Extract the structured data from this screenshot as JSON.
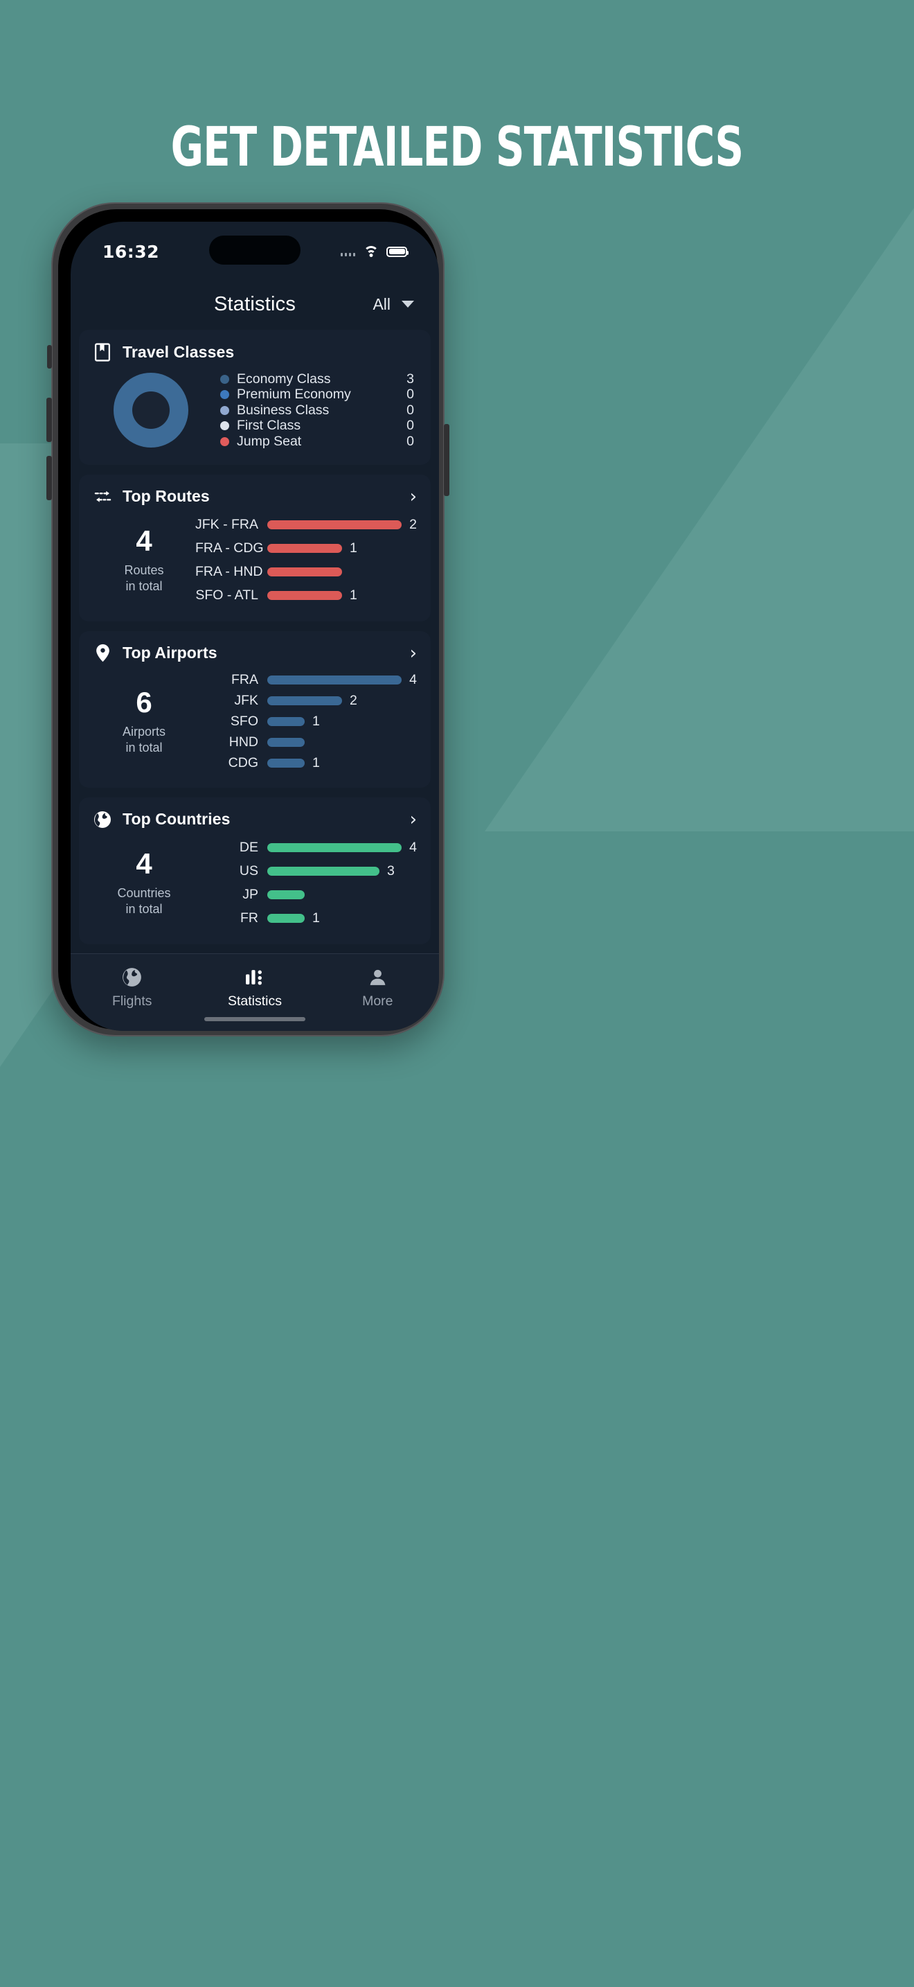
{
  "promo": {
    "headline": "GET DETAILED STATISTICS"
  },
  "theme": {
    "background": "#54918A",
    "screen_bg": "#141E2B",
    "card_bg": "#172130",
    "accent_blue": "#3D6B97",
    "accent_red": "#DC5A57",
    "accent_green": "#43C08A"
  },
  "status_bar": {
    "time": "16:32",
    "wifi": "wifi-icon",
    "battery": "battery-icon",
    "signal": "signal-dots-icon"
  },
  "nav": {
    "title": "Statistics",
    "filter_label": "All",
    "filter_caret": "chevron-down-icon"
  },
  "travel_classes": {
    "icon": "book-bookmark-icon",
    "title": "Travel Classes",
    "legend": [
      {
        "label": "Economy Class",
        "value": "3",
        "color": "#3A6389"
      },
      {
        "label": "Premium Economy",
        "value": "0",
        "color": "#3D79BE"
      },
      {
        "label": "Business Class",
        "value": "0",
        "color": "#90A8D0"
      },
      {
        "label": "First Class",
        "value": "0",
        "color": "#DDE3EC"
      },
      {
        "label": "Jump Seat",
        "value": "0",
        "color": "#E05C5C"
      }
    ]
  },
  "top_routes": {
    "icon": "route-arrows-icon",
    "title": "Top Routes",
    "chevron": "chevron-right-icon",
    "total_number": "4",
    "total_caption_line1": "Routes",
    "total_caption_line2": "in total",
    "rows": [
      {
        "label": "JFK - FRA",
        "value": "2",
        "pct": 100
      },
      {
        "label": "FRA - CDG",
        "value": "1",
        "pct": 50
      },
      {
        "label": "FRA - HND",
        "value": "",
        "pct": 50
      },
      {
        "label": "SFO - ATL",
        "value": "1",
        "pct": 50
      }
    ]
  },
  "top_airports": {
    "icon": "location-pin-icon",
    "title": "Top Airports",
    "chevron": "chevron-right-icon",
    "total_number": "6",
    "total_caption_line1": "Airports",
    "total_caption_line2": "in total",
    "rows": [
      {
        "label": "FRA",
        "value": "4",
        "pct": 100
      },
      {
        "label": "JFK",
        "value": "2",
        "pct": 50
      },
      {
        "label": "SFO",
        "value": "1",
        "pct": 25
      },
      {
        "label": "HND",
        "value": "",
        "pct": 25
      },
      {
        "label": "CDG",
        "value": "1",
        "pct": 25
      }
    ]
  },
  "top_countries": {
    "icon": "globe-icon",
    "title": "Top Countries",
    "chevron": "chevron-right-icon",
    "total_number": "4",
    "total_caption_line1": "Countries",
    "total_caption_line2": "in total",
    "rows": [
      {
        "label": "DE",
        "value": "4",
        "pct": 100
      },
      {
        "label": "US",
        "value": "3",
        "pct": 75
      },
      {
        "label": "JP",
        "value": "",
        "pct": 25
      },
      {
        "label": "FR",
        "value": "1",
        "pct": 25
      }
    ]
  },
  "tab_bar": {
    "tabs": [
      {
        "label": "Flights",
        "icon": "globe-icon",
        "active": false
      },
      {
        "label": "Statistics",
        "icon": "chart-bars-icon",
        "active": true
      },
      {
        "label": "More",
        "icon": "person-icon",
        "active": false
      }
    ]
  },
  "chart_data": [
    {
      "type": "pie",
      "title": "Travel Classes",
      "labels": [
        "Economy Class",
        "Premium Economy",
        "Business Class",
        "First Class",
        "Jump Seat"
      ],
      "values": [
        3,
        0,
        0,
        0,
        0
      ],
      "colors": [
        "#3A6389",
        "#3D79BE",
        "#90A8D0",
        "#DDE3EC",
        "#E05C5C"
      ],
      "legend": "right"
    },
    {
      "type": "bar",
      "title": "Top Routes",
      "orientation": "horizontal",
      "categories": [
        "JFK - FRA",
        "FRA - CDG",
        "FRA - HND",
        "SFO - ATL"
      ],
      "values": [
        2,
        1,
        1,
        1
      ],
      "color": "#DC5A57",
      "total": 4,
      "xlabel": "",
      "ylabel": ""
    },
    {
      "type": "bar",
      "title": "Top Airports",
      "orientation": "horizontal",
      "categories": [
        "FRA",
        "JFK",
        "SFO",
        "HND",
        "CDG"
      ],
      "values": [
        4,
        2,
        1,
        1,
        1
      ],
      "color": "#3A6894",
      "total": 6,
      "xlabel": "",
      "ylabel": ""
    },
    {
      "type": "bar",
      "title": "Top Countries",
      "orientation": "horizontal",
      "categories": [
        "DE",
        "US",
        "JP",
        "FR"
      ],
      "values": [
        4,
        3,
        1,
        1
      ],
      "color": "#43C08A",
      "total": 4,
      "xlabel": "",
      "ylabel": ""
    }
  ]
}
